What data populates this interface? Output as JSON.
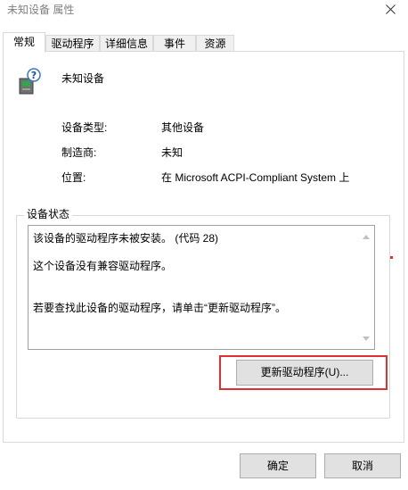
{
  "window": {
    "title": "未知设备 属性"
  },
  "tabs": [
    {
      "label": "常规"
    },
    {
      "label": "驱动程序"
    },
    {
      "label": "详细信息"
    },
    {
      "label": "事件"
    },
    {
      "label": "资源"
    }
  ],
  "device": {
    "name": "未知设备",
    "icon": "unknown-device-icon"
  },
  "properties": [
    {
      "label": "设备类型:",
      "value": "其他设备"
    },
    {
      "label": "制造商:",
      "value": "未知"
    },
    {
      "label": "位置:",
      "value": "在 Microsoft ACPI-Compliant System 上"
    }
  ],
  "status": {
    "legend": "设备状态",
    "lines": [
      "该设备的驱动程序未被安装。 (代码 28)",
      "这个设备没有兼容驱动程序。",
      "若要查找此设备的驱动程序，请单击“更新驱动程序”。"
    ],
    "update_button": "更新驱动程序(U)..."
  },
  "footer": {
    "ok": "确定",
    "cancel": "取消"
  },
  "colors": {
    "highlight": "#e03030"
  }
}
